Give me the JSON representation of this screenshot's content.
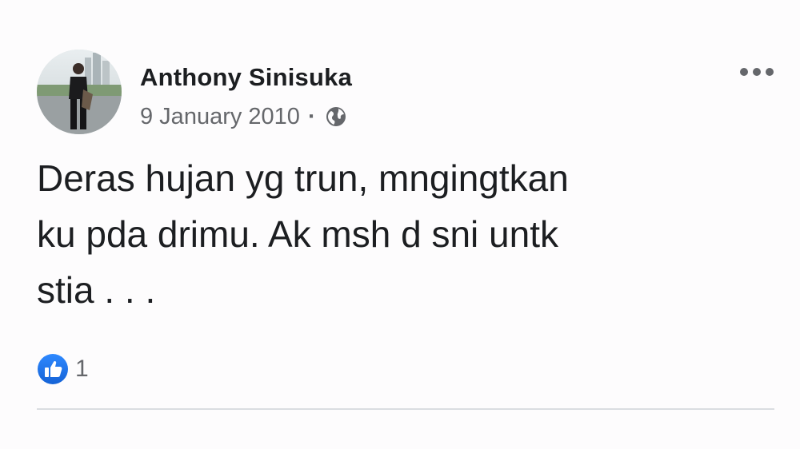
{
  "post": {
    "author": "Anthony Sinisuka",
    "date": "9 January 2010",
    "separator": "·",
    "audience_icon": "globe-icon",
    "text": "Deras hujan yg trun, mngingtkan\nku pda drimu. Ak msh d sni untk\nstia . . .",
    "reactions": {
      "icon": "like-icon",
      "count": "1"
    },
    "menu_icon": "more-options-icon"
  },
  "colors": {
    "background": "#fdfcfd",
    "text_primary": "#1c1e21",
    "text_secondary": "#65676b",
    "like_blue": "#1877f2",
    "divider": "#dadde1"
  }
}
